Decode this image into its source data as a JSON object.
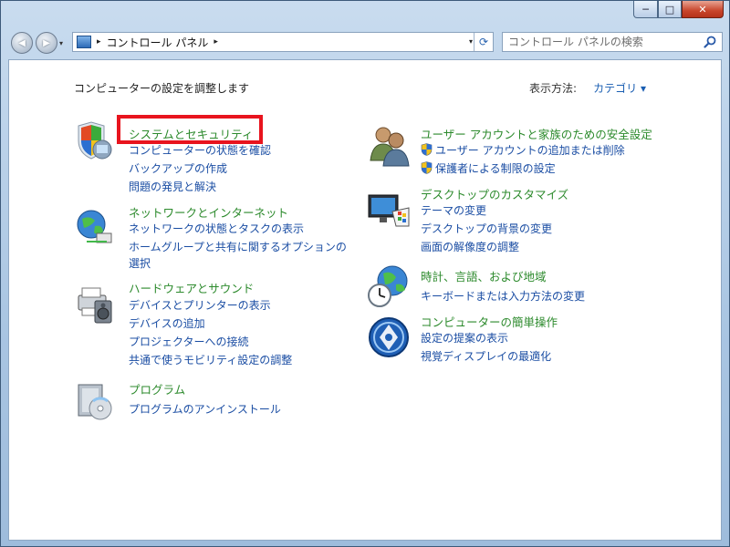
{
  "window": {
    "minimize_glyph": "─",
    "maximize_glyph": "□",
    "close_glyph": "✕"
  },
  "nav": {
    "back_glyph": "◀",
    "forward_glyph": "▶",
    "dropdown_glyph": "▾"
  },
  "address": {
    "crumb_arrow": "▸",
    "crumb": "コントロール パネル",
    "dropdown_glyph": "▾",
    "refresh_glyph": "⟳"
  },
  "search": {
    "placeholder": "コントロール パネルの検索"
  },
  "header": {
    "title": "コンピューターの設定を調整します",
    "view_by_label": "表示方法:",
    "view_by_value": "カテゴリ ▾"
  },
  "left_categories": [
    {
      "title": "システムとセキュリティ",
      "icon": "shield-computer-icon",
      "links": [
        "コンピューターの状態を確認",
        "バックアップの作成",
        "問題の発見と解決"
      ]
    },
    {
      "title": "ネットワークとインターネット",
      "icon": "globe-network-icon",
      "links": [
        "ネットワークの状態とタスクの表示",
        "ホームグループと共有に関するオプションの",
        "選択"
      ]
    },
    {
      "title": "ハードウェアとサウンド",
      "icon": "printer-speaker-icon",
      "links": [
        "デバイスとプリンターの表示",
        "デバイスの追加",
        "プロジェクターへの接続",
        "共通で使うモビリティ設定の調整"
      ]
    },
    {
      "title": "プログラム",
      "icon": "programs-disc-icon",
      "links": [
        "プログラムのアンインストール"
      ]
    }
  ],
  "right_categories": [
    {
      "title": "ユーザー アカウントと家族のための安全設定",
      "icon": "users-icon",
      "links": [
        "ユーザー アカウントの追加または削除",
        "保護者による制限の設定"
      ]
    },
    {
      "title": "デスクトップのカスタマイズ",
      "icon": "monitor-palette-icon",
      "links": [
        "テーマの変更",
        "デスクトップの背景の変更",
        "画面の解像度の調整"
      ]
    },
    {
      "title": "時計、言語、および地域",
      "icon": "globe-clock-icon",
      "links": [
        "キーボードまたは入力方法の変更"
      ]
    },
    {
      "title": "コンピューターの簡単操作",
      "icon": "ease-of-access-icon",
      "links": [
        "設定の提案の表示",
        "視覚ディスプレイの最適化"
      ]
    }
  ],
  "colors": {
    "category_title": "#2c8a2c",
    "link": "#1a4da3",
    "highlight_box": "#e8141e"
  }
}
